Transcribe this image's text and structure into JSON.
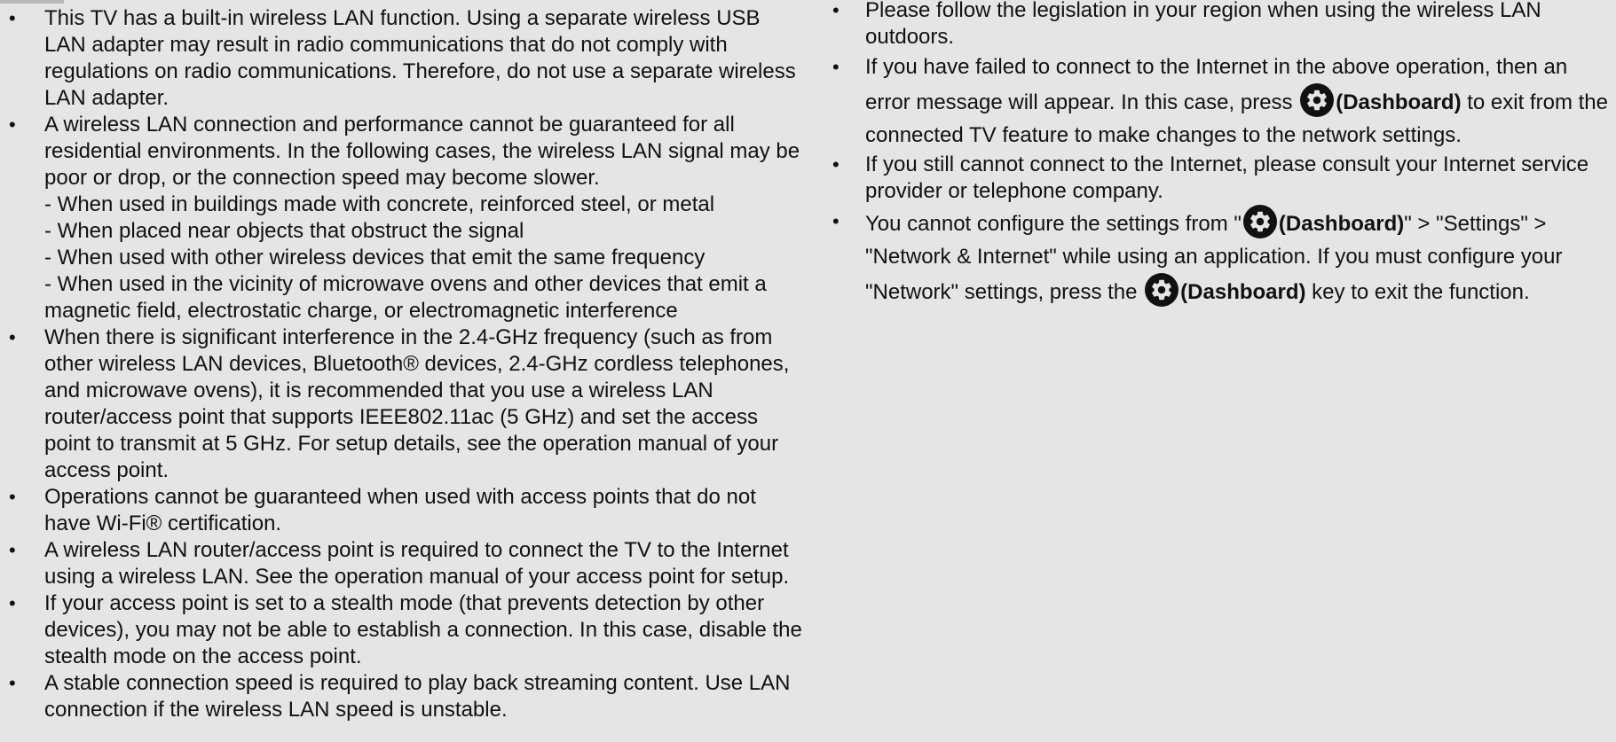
{
  "left_items": [
    {
      "text": "This TV has a built-in wireless LAN function. Using a separate wireless USB LAN adapter may result in radio communications that do not comply with regulations on radio communications. Therefore, do not use a separate wireless LAN adapter."
    },
    {
      "text": "A wireless LAN connection and performance cannot be guaranteed for all residential environments. In the following cases, the wireless LAN signal may be poor or drop, or the connection speed may become slower.",
      "cases": [
        "- When used in buildings made with concrete, reinforced steel, or metal",
        "- When placed near objects that obstruct the signal",
        "- When used with other wireless devices that emit the same frequency",
        "- When used in the vicinity of microwave ovens and other devices that emit a magnetic field, electrostatic charge, or electromagnetic interference"
      ]
    },
    {
      "text": "When there is significant interference in the 2.4-GHz frequency (such as from other wireless LAN devices, Bluetooth® devices, 2.4-GHz cordless telephones, and microwave ovens), it is recommended that you use a wireless LAN router/access point that supports IEEE802.11ac (5 GHz) and set the access point to transmit at 5 GHz. For setup details, see the operation manual of your access point."
    },
    {
      "text": "Operations cannot be guaranteed when used with access points that do not have Wi-Fi® certification."
    },
    {
      "text": "A wireless LAN router/access point is required to connect the TV to the Internet using a wireless LAN. See the operation manual of your access point for setup."
    },
    {
      "text": "If your access point is set to a stealth mode (that prevents detection by other devices), you may not be able to establish a connection. In this case, disable the stealth mode on the access point."
    },
    {
      "text": "A stable connection speed is required to play back streaming content. Use LAN connection if the wireless LAN speed is unstable."
    }
  ],
  "right_items": {
    "item1": "Please follow the legislation in your region when using the wireless LAN outdoors.",
    "item2_before": "If you have failed to connect to the Internet in the above operation, then an error message will appear. In this case, press ",
    "item2_bold": "(Dashboard)",
    "item2_after": " to exit from the connected TV feature to make changes to the network settings.",
    "item3": "If you still cannot connect to the Internet, please consult your Internet service provider or telephone company.",
    "item4_before": "You cannot configure the settings from \"",
    "item4_bold1": "(Dashboard)",
    "item4_mid": "\" > \"Settings\" > \"Network & Internet\" while using an application. If you must configure your \"Network\" settings, press the ",
    "item4_bold2": "(Dashboard)",
    "item4_after": " key to exit the function."
  },
  "icons": {
    "dashboard": "gear-icon"
  }
}
